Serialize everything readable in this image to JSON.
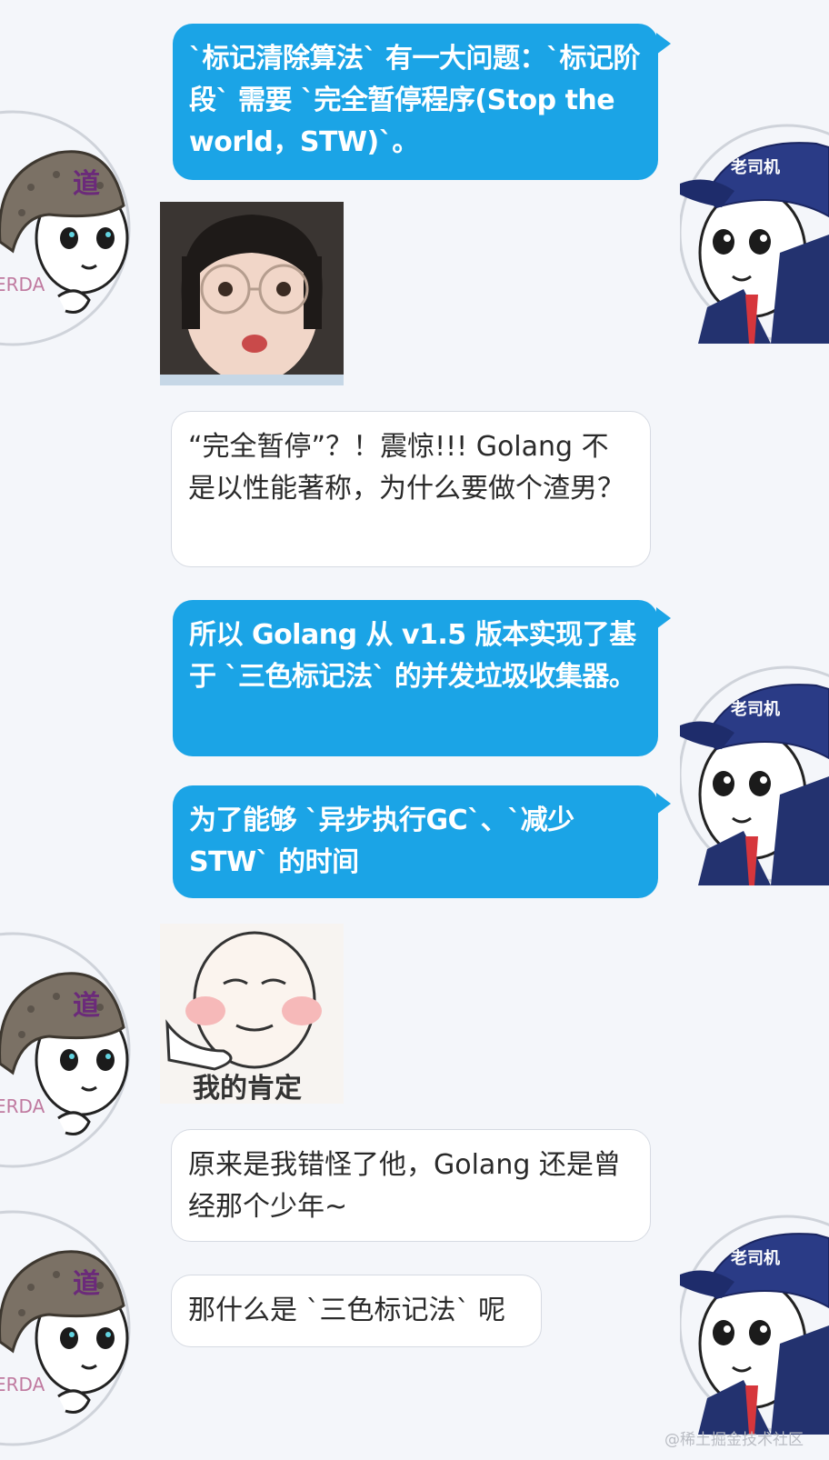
{
  "messages": [
    {
      "sender": "老司机",
      "text": "`标记清除算法` 有一大问题：`标记阶段` 需要 `完全暂停程序(Stop the world，STW)`。"
    },
    {
      "sender": "道",
      "type": "sticker",
      "description": "surprised-girl-with-glasses"
    },
    {
      "sender": "道",
      "text": "“完全暂停”？！震惊!!! Golang 不是以性能著称，为什么要做个渣男？"
    },
    {
      "sender": "老司机",
      "text": "所以 Golang 从 v1.5 版本实现了基于 `三色标记法` 的并发垃圾收集器。"
    },
    {
      "sender": "老司机",
      "text": "为了能够 `异步执行GC`、`减少 STW` 的时间"
    },
    {
      "sender": "道",
      "type": "sticker",
      "caption": "我的肯定"
    },
    {
      "sender": "道",
      "text": "原来是我错怪了他，Golang 还是曾经那个少年~"
    },
    {
      "sender": "道",
      "text": "那什么是 `三色标记法` 呢"
    }
  ],
  "avatars": {
    "left": {
      "badge": "道",
      "name_fragment": "ERDA"
    },
    "right": {
      "badge": "老司机"
    }
  },
  "watermark": "@稀土掘金技术社区",
  "colors": {
    "blue_bubble": "#1ba4e6",
    "white_bubble": "#ffffff",
    "background": "#f4f6fa"
  }
}
